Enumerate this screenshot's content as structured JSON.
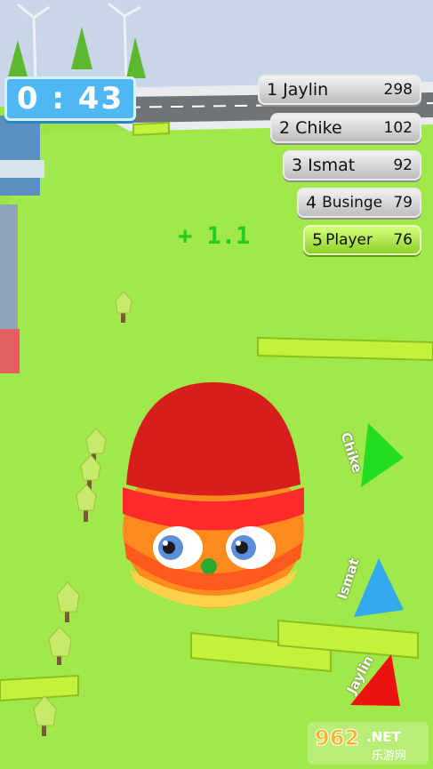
{
  "timer": {
    "text": "0 : 43"
  },
  "leaderboard": [
    {
      "rank": "1",
      "name": "Jaylin",
      "score": "298"
    },
    {
      "rank": "2",
      "name": "Chike",
      "score": "102"
    },
    {
      "rank": "3",
      "name": "Ismat",
      "score": "92"
    },
    {
      "rank": "4",
      "name": "Businge",
      "score": "79"
    },
    {
      "rank": "5",
      "name": "Player",
      "score": "76"
    }
  ],
  "score_popup": "+ 1.1",
  "pointers": [
    {
      "name": "Chike",
      "color": "#22dd22"
    },
    {
      "name": "Ismat",
      "color": "#33aaee"
    },
    {
      "name": "Jaylin",
      "color": "#ee1111"
    }
  ],
  "watermark": {
    "brand": "962.NET",
    "sub": "乐游网"
  }
}
